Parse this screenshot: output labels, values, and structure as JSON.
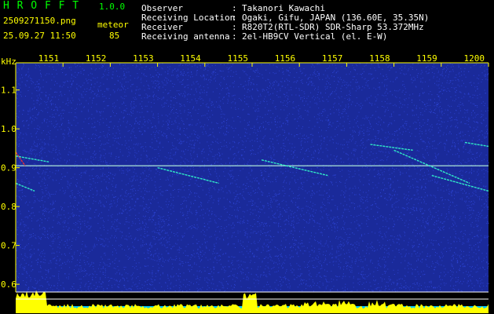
{
  "header": {
    "app_title": "H R O F F T",
    "version": "1.0.0",
    "filename": "2509271150.png",
    "mode_label": "meteor",
    "datetime": "25.09.27 11:50",
    "meteor_count": "85",
    "info_labels": [
      "Observer",
      "Receiving Location",
      "Receiver",
      "Receiving antenna"
    ],
    "info_separator": ":",
    "info_values": [
      "Takanori Kawachi",
      "Ogaki, Gifu, JAPAN (136.60E, 35.35N)",
      "R820T2(RTL-SDR) SDR-Sharp 53.372MHz",
      "2el-HB9CV Vertical (el. E-W)"
    ]
  },
  "spectrogram": {
    "y_unit": "kHz",
    "y_ticks": [
      "1.1",
      "1.0",
      "0.9",
      "0.8",
      "0.7",
      "0.6"
    ],
    "y_range": [
      0.58,
      1.17
    ],
    "time_labels": [
      "1151",
      "1152",
      "1153",
      "1154",
      "1155",
      "1156",
      "1157",
      "1158",
      "1159",
      "1200"
    ],
    "background_color": "#1a2a9a",
    "noise_color": "#3a55ff",
    "tick_color": "#ffff00",
    "reference_line_khz": 0.905,
    "meteor_traces": [
      {
        "t_start": 1150.0,
        "t_end": 1150.2,
        "f_start": 0.94,
        "f_end": 0.905,
        "color": "#ff3030"
      },
      {
        "t_start": 1150.0,
        "t_end": 1150.7,
        "f_start": 0.93,
        "f_end": 0.915,
        "color": "#33ffcc"
      },
      {
        "t_start": 1150.0,
        "t_end": 1150.4,
        "f_start": 0.86,
        "f_end": 0.84,
        "color": "#33ffcc"
      },
      {
        "t_start": 1153.0,
        "t_end": 1154.3,
        "f_start": 0.9,
        "f_end": 0.86,
        "color": "#33ffcc"
      },
      {
        "t_start": 1155.2,
        "t_end": 1156.6,
        "f_start": 0.92,
        "f_end": 0.88,
        "color": "#33ffcc"
      },
      {
        "t_start": 1157.5,
        "t_end": 1158.4,
        "f_start": 0.96,
        "f_end": 0.945,
        "color": "#33ffcc"
      },
      {
        "t_start": 1158.0,
        "t_end": 1159.6,
        "f_start": 0.945,
        "f_end": 0.86,
        "color": "#33ffcc"
      },
      {
        "t_start": 1159.5,
        "t_end": 1160.0,
        "f_start": 0.965,
        "f_end": 0.955,
        "color": "#33ffcc"
      },
      {
        "t_start": 1158.8,
        "t_end": 1160.0,
        "f_start": 0.88,
        "f_end": 0.84,
        "color": "#33ffcc"
      }
    ]
  },
  "signal_strip": {
    "bar_color": "#ffff00",
    "base_color": "#00c8ff",
    "line_color": "#ffffff"
  }
}
